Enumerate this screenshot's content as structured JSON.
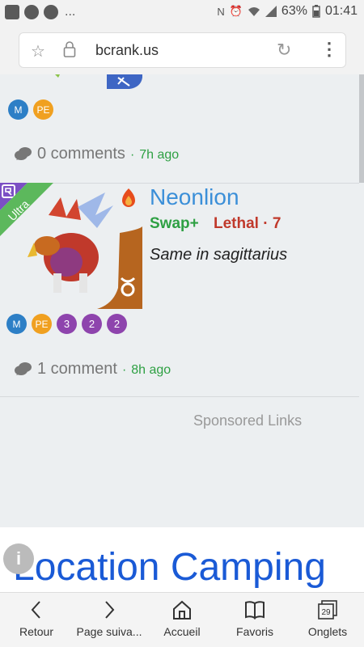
{
  "status_bar": {
    "battery": "63%",
    "time": "01:41",
    "left_dots": "...",
    "icons": [
      "photo-icon",
      "messenger-icon",
      "messenger-icon",
      "nfc-icon",
      "alarm-icon",
      "wifi-icon",
      "signal-icon",
      "battery-icon"
    ]
  },
  "address_bar": {
    "url": "bcrank.us",
    "icons": [
      "star-icon",
      "lock-icon",
      "reload-icon",
      "menu-icon"
    ]
  },
  "feed": {
    "item1": {
      "badges": [
        "M",
        "PE"
      ],
      "comment_count": "0 comments",
      "separator": "·",
      "time_ago": "7h ago"
    },
    "item2": {
      "rarity_label": "Ultra",
      "title": "Neonlion",
      "tag_swap": "Swap+",
      "tag_lethal": "Lethal · 7",
      "description": "Same in sagittarius",
      "badges": [
        "M",
        "PE",
        "3",
        "2",
        "2"
      ],
      "comment_count": "1 comment",
      "separator": "·",
      "time_ago": "8h ago"
    }
  },
  "sponsored": "Sponsored Links",
  "ad": {
    "text": "Location Camping",
    "info_icon": "i"
  },
  "nav": [
    {
      "label": "Retour",
      "icon": "back-icon"
    },
    {
      "label": "Page suiva...",
      "icon": "forward-icon"
    },
    {
      "label": "Accueil",
      "icon": "home-icon"
    },
    {
      "label": "Favoris",
      "icon": "bookmarks-icon"
    },
    {
      "label": "Onglets",
      "icon": "tabs-icon",
      "count": "29"
    }
  ],
  "colors": {
    "link_blue": "#3b8fd8",
    "green": "#2ea043",
    "red": "#c0392b",
    "badge_blue": "#2d7fc6",
    "badge_orange": "#f0a020",
    "badge_purple": "#8e44ad",
    "ultra_green": "#4caf50",
    "ad_blue": "#1a5ad6"
  }
}
